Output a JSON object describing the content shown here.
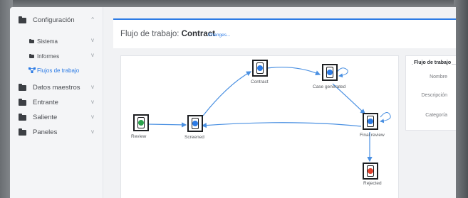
{
  "sidebar": {
    "items": [
      {
        "label": "Configuración",
        "chevron": "^"
      },
      {
        "label": "Sistema",
        "chevron": "v"
      },
      {
        "label": "Informes",
        "chevron": "v"
      },
      {
        "label": "Flujos de trabajo",
        "chevron": ""
      },
      {
        "label": "Datos maestros",
        "chevron": "v"
      },
      {
        "label": "Entrante",
        "chevron": "v"
      },
      {
        "label": "Saliente",
        "chevron": "v"
      },
      {
        "label": "Paneles",
        "chevron": "v"
      }
    ]
  },
  "header": {
    "title_prefix": "Flujo de trabajo: ",
    "title_name": "Contract",
    "changes_link": "Changes..."
  },
  "workflow": {
    "nodes": [
      {
        "label": "Review",
        "state": "green"
      },
      {
        "label": "Screened",
        "state": "blue"
      },
      {
        "label": "Contract",
        "state": "blue"
      },
      {
        "label": "Case generated",
        "state": "blue"
      },
      {
        "label": "Final review",
        "state": "blue"
      },
      {
        "label": "Rejected",
        "state": "red"
      }
    ]
  },
  "panel": {
    "legend": "Flujo de trabajo",
    "fields": [
      "Nombre",
      "Descripción",
      "Categoría"
    ]
  },
  "colors": {
    "accent": "#2c7be5",
    "connector": "#4a90e2",
    "node_green": "#2ba24c",
    "node_blue": "#2c7be5",
    "node_red": "#e0402b"
  }
}
